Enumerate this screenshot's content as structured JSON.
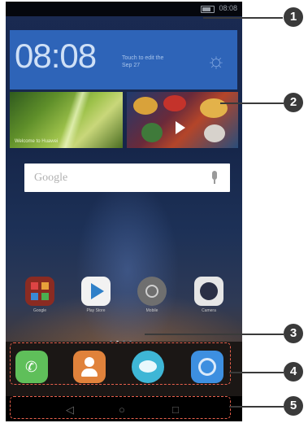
{
  "status_bar": {
    "time": "08:08"
  },
  "weather_widget": {
    "clock": "08:08",
    "info_line1": "Touch to edit the",
    "info_line2": "Sep 27"
  },
  "tiles": {
    "left_caption": "Welcome to Huawei"
  },
  "search": {
    "placeholder": "Google"
  },
  "apps": [
    {
      "label": "Google",
      "color": "#c0392b"
    },
    {
      "label": "Play Store",
      "color": "#2f80c8"
    },
    {
      "label": "Mobile",
      "color": "#7f7f7f"
    },
    {
      "label": "Camera",
      "color": "#2a2f45"
    }
  ],
  "dock": [
    {
      "name": "phone",
      "color": "#5fbf5a"
    },
    {
      "name": "contacts",
      "color": "#e0823b"
    },
    {
      "name": "messaging",
      "color": "#3eb6d6"
    },
    {
      "name": "browser",
      "color": "#3d8fe0"
    }
  ],
  "callouts": [
    "1",
    "2",
    "3",
    "4",
    "5"
  ],
  "accent_color": "#e8604c"
}
